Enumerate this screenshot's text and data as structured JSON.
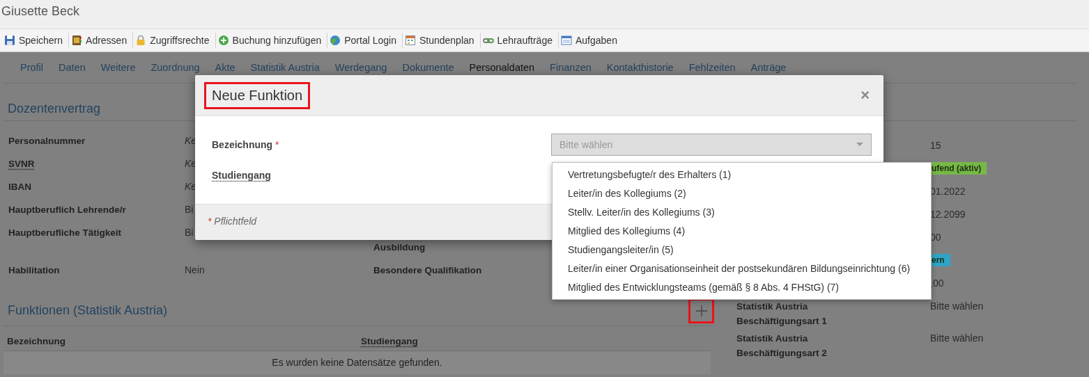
{
  "header": {
    "title": "Giusette Beck"
  },
  "toolbar": [
    {
      "label": "Speichern",
      "kind": "save"
    },
    {
      "label": "Adressen",
      "kind": "book"
    },
    {
      "label": "Zugriffsrechte",
      "kind": "lock"
    },
    {
      "label": "Buchung hinzufügen",
      "kind": "add"
    },
    {
      "label": "Portal Login",
      "kind": "globe"
    },
    {
      "label": "Stundenplan",
      "kind": "calendar"
    },
    {
      "label": "Lehraufträge",
      "kind": "link"
    },
    {
      "label": "Aufgaben",
      "kind": "list"
    }
  ],
  "tabs": [
    {
      "label": "Profil",
      "selected": false
    },
    {
      "label": "Daten",
      "selected": false
    },
    {
      "label": "Weitere",
      "selected": false
    },
    {
      "label": "Zuordnung",
      "selected": false
    },
    {
      "label": "Akte",
      "selected": false
    },
    {
      "label": "Statistik Austria",
      "selected": false
    },
    {
      "label": "Werdegang",
      "selected": false
    },
    {
      "label": "Dokumente",
      "selected": false
    },
    {
      "label": "Personaldaten",
      "selected": true
    },
    {
      "label": "Finanzen",
      "selected": false
    },
    {
      "label": "Kontakthistorie",
      "selected": false
    },
    {
      "label": "Fehlzeiten",
      "selected": false
    },
    {
      "label": "Anträge",
      "selected": false
    }
  ],
  "contract": {
    "title": "Dozentenvertrag",
    "rows": [
      {
        "label": "Personalnummer",
        "has_tooltip": false,
        "value": "Ke",
        "unset": true
      },
      {
        "label": "SVNR",
        "has_tooltip": true,
        "value": "Ke",
        "unset": true
      },
      {
        "label": "IBAN",
        "has_tooltip": false,
        "value": "Ke",
        "unset": true
      },
      {
        "label": "Hauptberuflich Lehrende/r",
        "has_tooltip": false,
        "value": "Bi",
        "unset": false
      },
      {
        "label": "Hauptberufliche Tätigkeit",
        "has_tooltip": false,
        "value": "Bi",
        "unset": false,
        "label_2": "Ausbildung"
      },
      {
        "label": "Habilitation",
        "has_tooltip": false,
        "value": "Nein",
        "unset": false,
        "label_2": "Besondere Qualifikation"
      }
    ],
    "side_rows": [
      {
        "value": "15",
        "kind": "text"
      },
      {
        "value": "ufend (aktiv)",
        "kind": "badge",
        "color": "#76b846"
      },
      {
        "value": "01.2022",
        "kind": "text"
      },
      {
        "value": "12.2099",
        "kind": "text"
      },
      {
        "value": "00",
        "kind": "text"
      },
      {
        "value": "ern",
        "kind": "badge",
        "color": "#2fa4c6"
      },
      {
        "value": ",00",
        "kind": "text"
      },
      {
        "label": "Statistik Austria Beschäftigungsart 1",
        "value": "Bitte wählen",
        "kind": "text"
      },
      {
        "label": "Statistik Austria Beschäftigungsart 2",
        "value": "Bitte wählen",
        "kind": "text"
      }
    ]
  },
  "functions": {
    "title": "Funktionen (Statistik Austria)",
    "add_marked": true,
    "columns": [
      {
        "label": "Bezeichnung",
        "has_tooltip": false
      },
      {
        "label": "Studiengang",
        "has_tooltip": true
      }
    ],
    "empty_message": "Es wurden keine Datensätze gefunden."
  },
  "dialog": {
    "title": "Neue Funktion",
    "title_marked": true,
    "close": "×",
    "required_mark": "*",
    "fields": [
      {
        "label": "Bezeichnung",
        "required": true,
        "has_tooltip": false,
        "placeholder": "Bitte wählen"
      },
      {
        "label": "Studiengang",
        "required": false,
        "has_tooltip": true
      }
    ],
    "footer_note": "Pflichtfeld"
  },
  "dropdown": {
    "options": [
      {
        "label": "Vertretungsbefugte/r des Erhalters (1)",
        "selected": false
      },
      {
        "label": "Leiter/in des Kollegiums (2)",
        "selected": false
      },
      {
        "label": "Stellv. Leiter/in des Kollegiums (3)",
        "selected": false
      },
      {
        "label": "Mitglied des Kollegiums (4)",
        "selected": false
      },
      {
        "label": "Studiengangsleiter/in (5)",
        "selected": false
      },
      {
        "label": "Leiter/in einer Organisationseinheit der postsekundären Bildungseinrichtung (6)",
        "selected": false
      },
      {
        "label": "Mitglied des Entwicklungsteams (gemäß § 8 Abs. 4 FHStG) (7)",
        "selected": false
      }
    ]
  }
}
